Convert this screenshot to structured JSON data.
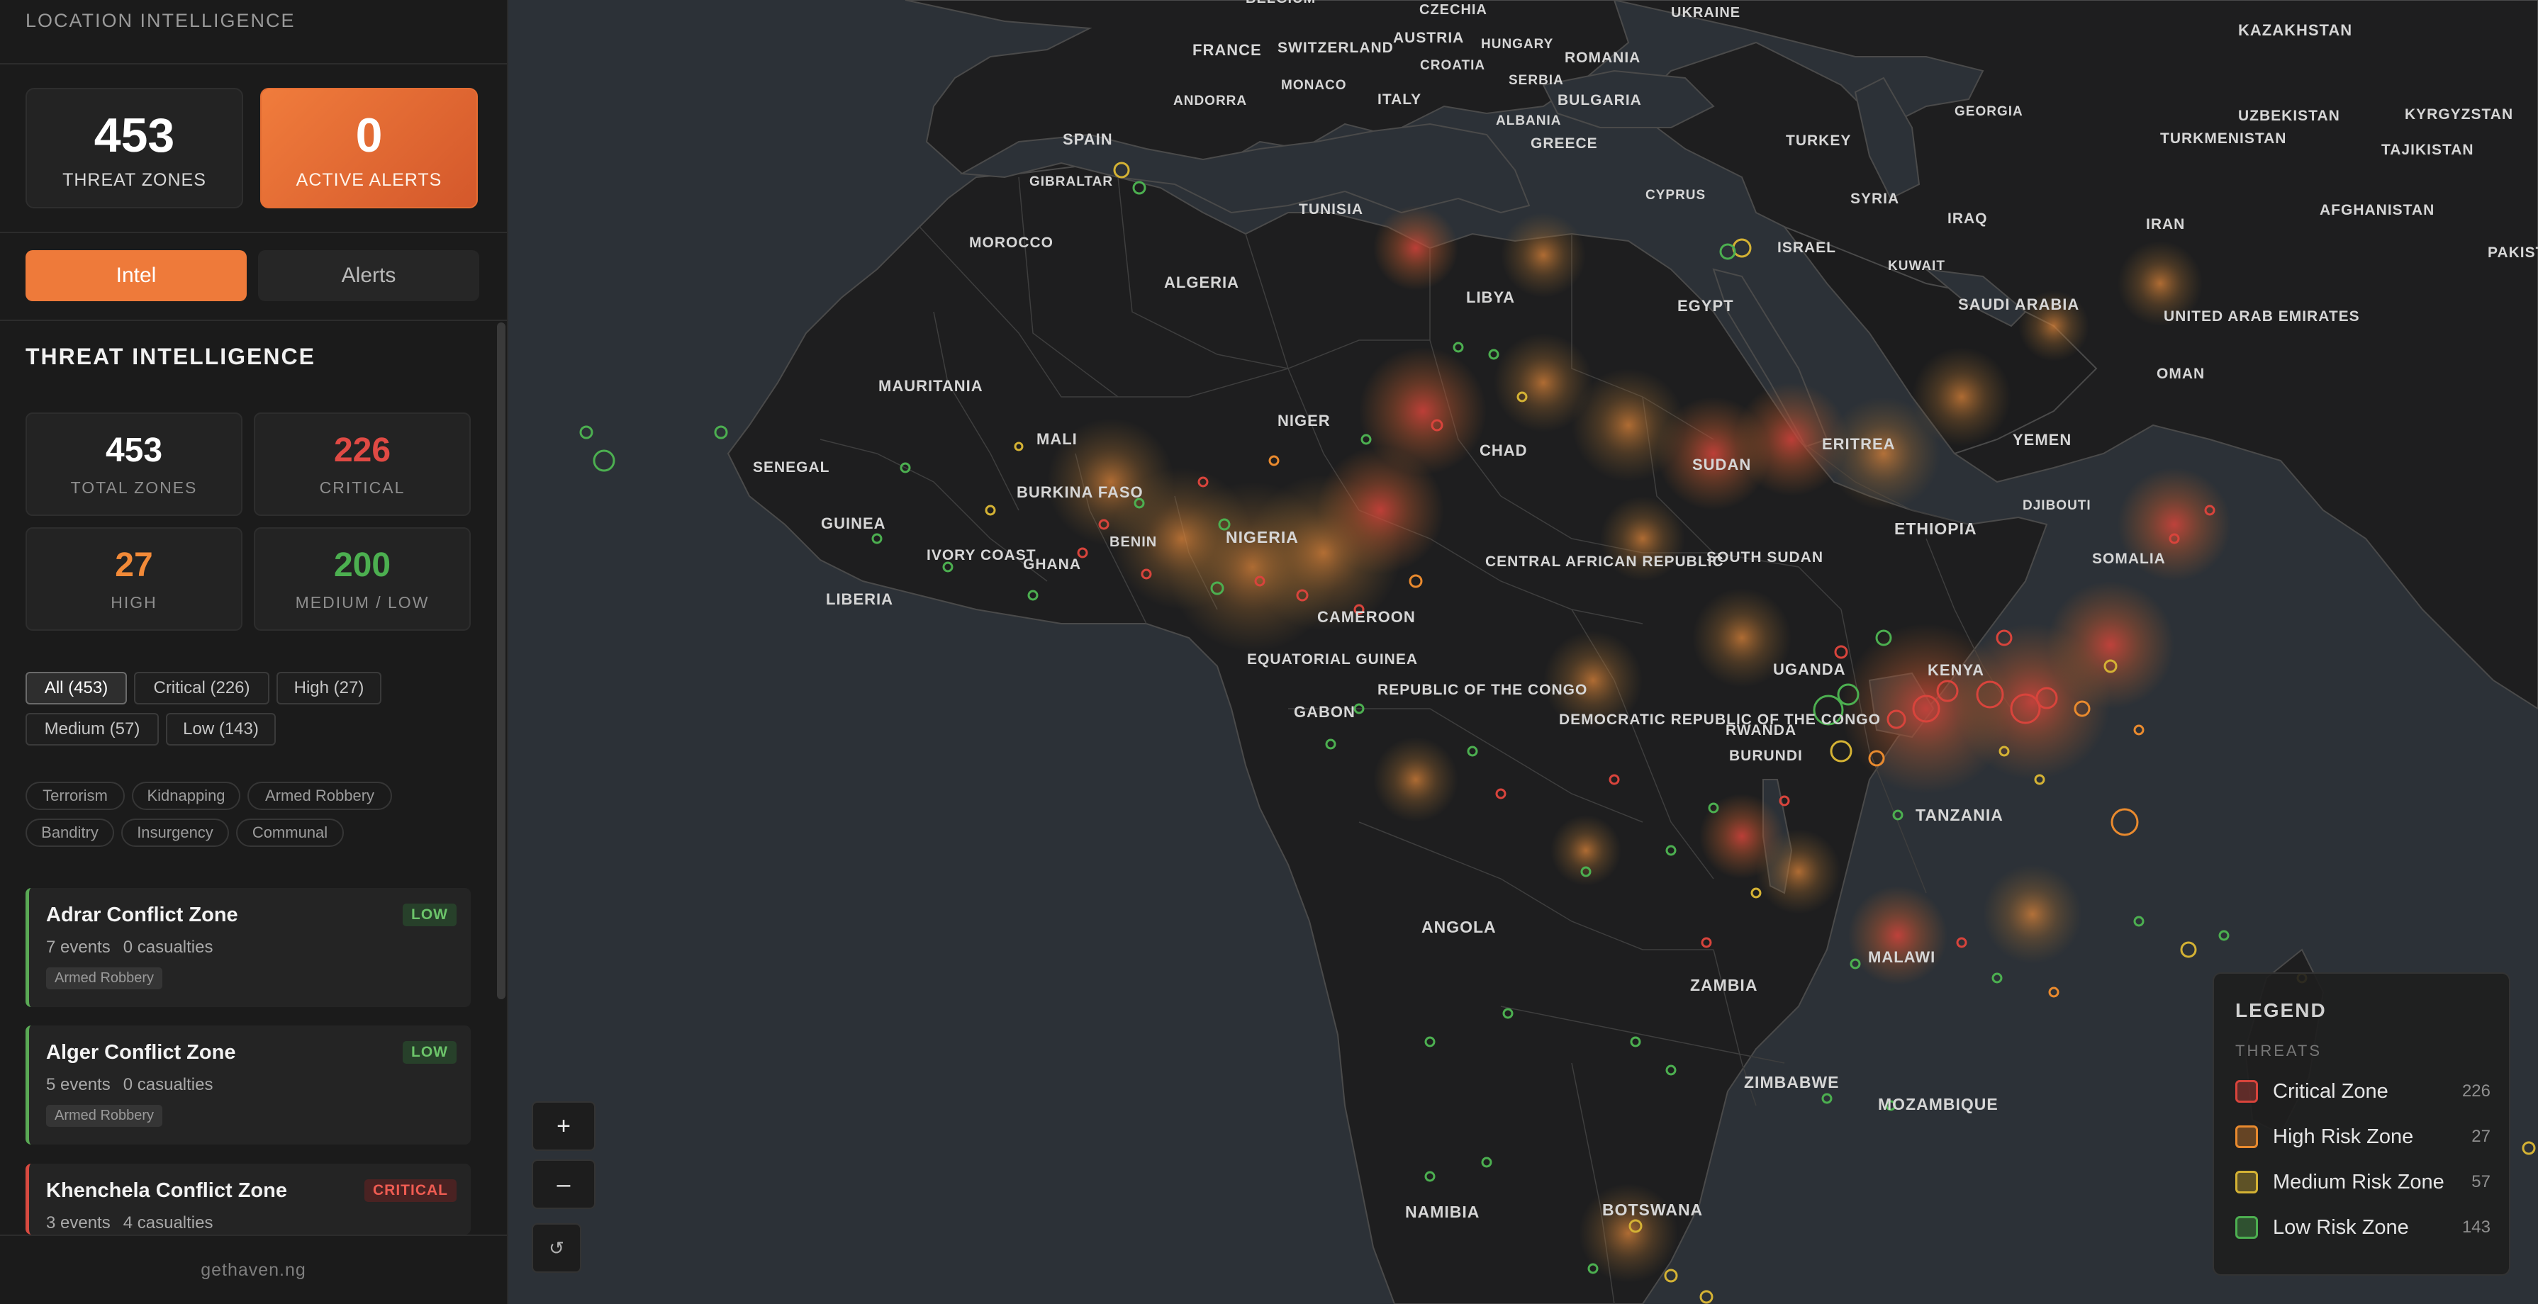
{
  "sidebar": {
    "header": "LOCATION INTELLIGENCE",
    "top_stats": {
      "threat_zones": {
        "value": "453",
        "label": "THREAT ZONES"
      },
      "active_alerts": {
        "value": "0",
        "label": "ACTIVE ALERTS"
      }
    },
    "tabs": [
      {
        "label": "Intel",
        "active": true
      },
      {
        "label": "Alerts",
        "active": false
      }
    ],
    "section_title": "THREAT INTELLIGENCE",
    "stats": {
      "total": {
        "value": "453",
        "label": "TOTAL ZONES"
      },
      "critical": {
        "value": "226",
        "label": "CRITICAL"
      },
      "high": {
        "value": "27",
        "label": "HIGH"
      },
      "medium_low": {
        "value": "200",
        "label": "MEDIUM / LOW"
      }
    },
    "filters": [
      "All (453)",
      "Critical (226)",
      "High (27)",
      "Medium (57)",
      "Low (143)"
    ],
    "active_filter": "All (453)",
    "tags": [
      "Terrorism",
      "Kidnapping",
      "Armed Robbery",
      "Banditry",
      "Insurgency",
      "Communal"
    ],
    "zones": [
      {
        "name": "Adrar Conflict Zone",
        "events": "7 events",
        "casualties": "0 casualties",
        "badge": "LOW",
        "tag": "Armed Robbery"
      },
      {
        "name": "Alger Conflict Zone",
        "events": "5 events",
        "casualties": "0 casualties",
        "badge": "LOW",
        "tag": "Armed Robbery"
      },
      {
        "name": "Khenchela Conflict Zone",
        "events": "3 events",
        "casualties": "4 casualties",
        "badge": "CRITICAL",
        "tag": ""
      }
    ],
    "footer": "gethaven.ng"
  },
  "map": {
    "zoom_in_label": "+",
    "zoom_out_label": "–",
    "reset_label": "↺",
    "country_labels": [
      "BELGIUM",
      "CZECHIA",
      "UKRAINE",
      "KAZAKHSTAN",
      "FRANCE",
      "SWITZERLAND",
      "AUSTRIA",
      "HUNGARY",
      "ROMANIA",
      "MONACO",
      "CROATIA",
      "ANDORRA",
      "ITALY",
      "SERBIA",
      "BULGARIA",
      "GEORGIA",
      "UZBEKISTAN",
      "KYRGYZSTAN",
      "ALBANIA",
      "SPAIN",
      "TURKMENISTAN",
      "GREECE",
      "TURKEY",
      "TAJIKISTAN",
      "GIBRALTAR",
      "CYPRUS",
      "SYRIA",
      "IRAQ",
      "TUNISIA",
      "AFGHANISTAN",
      "MOROCCO",
      "ISRAEL",
      "IRAN",
      "KUWAIT",
      "PAKISTAN",
      "ALGERIA",
      "LIBYA",
      "EGYPT",
      "SAUDI ARABIA",
      "UNITED ARAB EMIRATES",
      "MAURITANIA",
      "OMAN",
      "MALI",
      "NIGER",
      "CHAD",
      "SUDAN",
      "ERITREA",
      "YEMEN",
      "SENEGAL",
      "BURKINA FASO",
      "DJIBOUTI",
      "GUINEA",
      "BENIN",
      "NIGERIA",
      "ETHIOPIA",
      "IVORY COAST",
      "GHANA",
      "CENTRAL AFRICAN REPUBLIC",
      "SOUTH SUDAN",
      "SOMALIA",
      "LIBERIA",
      "CAMEROON",
      "EQUATORIAL GUINEA",
      "UGANDA",
      "KENYA",
      "GABON",
      "REPUBLIC OF THE CONGO",
      "DEMOCRATIC REPUBLIC OF THE CONGO",
      "RWANDA",
      "BURUNDI",
      "TANZANIA",
      "ANGOLA",
      "ZAMBIA",
      "MALAWI",
      "ZIMBABWE",
      "MOZAMBIQUE",
      "NAMIBIA",
      "BOTSWANA"
    ]
  },
  "legend": {
    "title": "LEGEND",
    "subtitle": "THREATS",
    "items": [
      {
        "label": "Critical Zone",
        "count": "226",
        "color": "#d8443c"
      },
      {
        "label": "High Risk Zone",
        "count": "27",
        "color": "#e98a2e"
      },
      {
        "label": "Medium Risk Zone",
        "count": "57",
        "color": "#d4b234"
      },
      {
        "label": "Low Risk Zone",
        "count": "143",
        "color": "#4caf50"
      }
    ]
  }
}
